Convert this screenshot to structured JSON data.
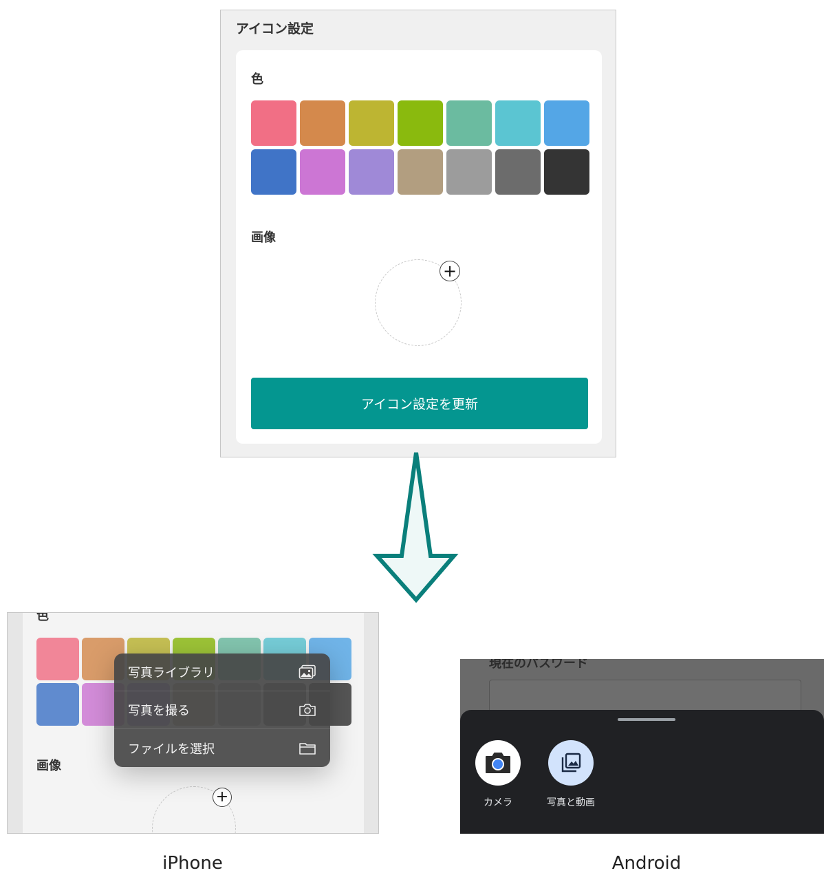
{
  "top_panel": {
    "title": "アイコン設定",
    "color_label": "色",
    "image_label": "画像",
    "plus_symbol": "+",
    "update_button": "アイコン設定を更新",
    "colors": [
      "#f16f85",
      "#d4894c",
      "#bdb532",
      "#8aba0e",
      "#6bbba0",
      "#5bc5d2",
      "#54a6e6",
      "#4074c7",
      "#cc76d4",
      "#9f89d7",
      "#b29e80",
      "#9c9c9c",
      "#6c6c6c",
      "#343434"
    ]
  },
  "iphone": {
    "color_label": "色",
    "image_label": "画像",
    "plus_symbol": "+",
    "menu": [
      {
        "label": "写真ライブラリ",
        "icon": "photo-library-icon"
      },
      {
        "label": "写真を撮る",
        "icon": "camera-icon"
      },
      {
        "label": "ファイルを選択",
        "icon": "folder-icon"
      }
    ],
    "caption": "iPhone"
  },
  "android": {
    "background_label": "現在のパスワード",
    "options": [
      {
        "label": "カメラ",
        "icon": "camera-icon"
      },
      {
        "label": "写真と動画",
        "icon": "photos-icon"
      }
    ],
    "caption": "Android"
  },
  "theme": {
    "accent": "#049690",
    "arrow_stroke": "#0a7f7b",
    "arrow_fill": "#eef8f7"
  }
}
